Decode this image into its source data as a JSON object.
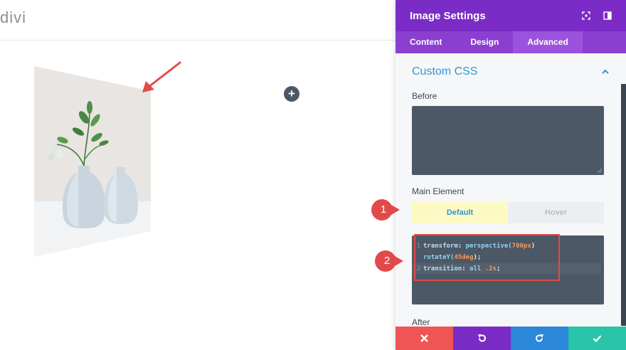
{
  "canvas": {
    "logo_text": "divi",
    "add_button_label": "+"
  },
  "panel": {
    "title": "Image Settings",
    "header_icons": [
      "fullscreen-icon",
      "sidebar-toggle-icon"
    ],
    "tabs": [
      {
        "label": "Content",
        "active": false
      },
      {
        "label": "Design",
        "active": false
      },
      {
        "label": "Advanced",
        "active": true
      }
    ],
    "section_title": "Custom CSS",
    "fields": {
      "before_label": "Before",
      "before_value": "",
      "main_element_label": "Main Element",
      "state_default": "Default",
      "state_hover": "Hover",
      "after_label": "After"
    },
    "code": {
      "line1_num": "1",
      "line1_prop": "transform",
      "line1_func": "perspective(",
      "line1_num_val": "700px",
      "line1_close": ")",
      "line1b_func": "rotateY(",
      "line1b_num_val": "45deg",
      "line1b_close": ");",
      "line2_num": "2",
      "line2_prop": "transition",
      "line2_value": "all",
      "line2_num_val": ".2s",
      "line2_close": ";"
    },
    "footer": [
      "close-icon",
      "undo-icon",
      "redo-icon",
      "check-icon"
    ]
  },
  "callouts": {
    "badge1": "1",
    "badge2": "2"
  },
  "colors": {
    "header_purple": "#7b2cc6",
    "tab_purple": "#8a3fd0",
    "accent_blue": "#2e98d5",
    "callout_red": "#e24a4a",
    "cancel_red": "#ef5555",
    "redo_blue": "#2b87da",
    "save_green": "#29c4a9"
  }
}
